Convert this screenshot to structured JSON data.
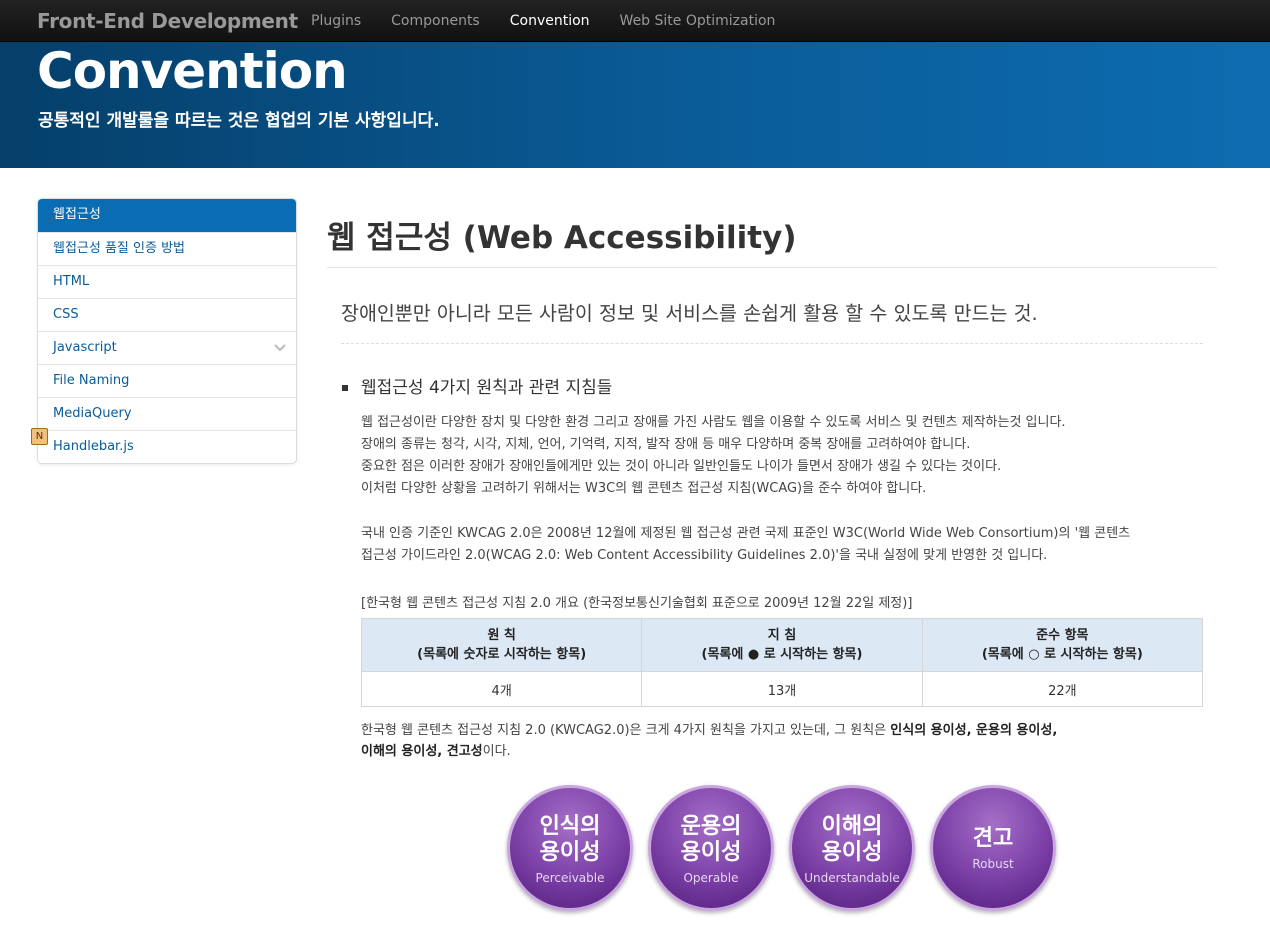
{
  "navbar": {
    "brand": "Front-End Development",
    "items": [
      "Plugins",
      "Components",
      "Convention",
      "Web Site Optimization"
    ],
    "active": "Convention"
  },
  "hero": {
    "title": "Convention",
    "subtitle": "공통적인 개발룰을 따르는 것은 협업의 기본 사항입니다."
  },
  "sidebar": {
    "items": [
      {
        "label": "웹접근성"
      },
      {
        "label": "웹접근성 품질 인증 방법"
      },
      {
        "label": "HTML"
      },
      {
        "label": "CSS"
      },
      {
        "label": "Javascript"
      },
      {
        "label": "File Naming"
      },
      {
        "label": "MediaQuery"
      },
      {
        "label": "Handlebar.js"
      }
    ],
    "badge": "N"
  },
  "content": {
    "title_ko": "웹 접근성",
    "title_en": "(Web Accessibility)",
    "lead": "장애인뿐만 아니라 모든 사람이 정보 및 서비스를 손쉽게 활용 할 수 있도록 만드는 것.",
    "section_title": "웹접근성 4가지 원칙과 관련 지침들",
    "paragraph1": [
      "웹 접근성이란 다양한 장치 및 다양한 환경 그리고 장애를 가진 사람도 웹을 이용할 수 있도록 서비스 및 컨텐츠 제작하는것 입니다.",
      "장애의 종류는 청각, 시각, 지체, 언어, 기억력, 지적, 발작 장애 등 매우 다양하며 중복 장애를 고려하여야 합니다.",
      "중요한 점은 이러한 장애가 장애인들에게만 있는 것이 아니라 일반인들도 나이가 들면서 장애가 생길 수 있다는 것이다.",
      "이처럼 다양한 상황을 고려하기 위해서는 W3C의 웹 콘텐츠 접근성 지침(WCAG)을 준수 하여야 합니다."
    ],
    "paragraph2": [
      "국내 인증 기준인 KWCAG 2.0은 2008년 12월에 제정된 웹 접근성 관련 국제 표준인 W3C(World Wide Web Consortium)의 '웹 콘텐츠",
      "접근성 가이드라인 2.0(WCAG 2.0: Web Content Accessibility Guidelines 2.0)'을 국내 실정에 맞게 반영한 것 입니다."
    ],
    "table_caption": "[한국형 웹 콘텐츠 접근성 지침 2.0 개요 (한국정보통신기술협회 표준으로 2009년 12월 22일 제정)]",
    "table": {
      "headers": [
        {
          "title": "원 칙",
          "sub": "(목록에 숫자로 시작하는 항목)"
        },
        {
          "title": "지 침",
          "sub": "(목록에 ● 로 시작하는 항목)"
        },
        {
          "title": "준수 항목",
          "sub": "(목록에 ○ 로 시작하는 항목)"
        }
      ],
      "row": [
        "4개",
        "13개",
        "22개"
      ]
    },
    "summary_plain": "한국형 웹 콘텐츠 접근성 지침 2.0 (KWCAG2.0)은 크게 4가지 원칙을 가지고 있는데, 그 원칙은 ",
    "summary_bold1": "인식의 용이성, 운용의 용이성,",
    "summary_bold2": "이해의 용이성, 견고성",
    "summary_end": "이다.",
    "principles": [
      {
        "line1": "인식의",
        "line2": "용이성",
        "en": "Perceivable"
      },
      {
        "line1": "운용의",
        "line2": "용이성",
        "en": "Operable"
      },
      {
        "line1": "이해의",
        "line2": "용이성",
        "en": "Understandable"
      },
      {
        "line1": "견고",
        "line2": "",
        "en": "Robust"
      }
    ]
  },
  "colors": {
    "navbar": "#111111",
    "hero": "#0a5c98",
    "sidebar_active": "#0a6cb3",
    "link": "#0a5c98",
    "table_header": "#dce9f5",
    "principle_circle": "#7a3ea6"
  },
  "icons": {
    "chevron": "chevron-down-icon",
    "new_badge": "new-badge-icon",
    "bullet": "square-bullet-icon"
  }
}
